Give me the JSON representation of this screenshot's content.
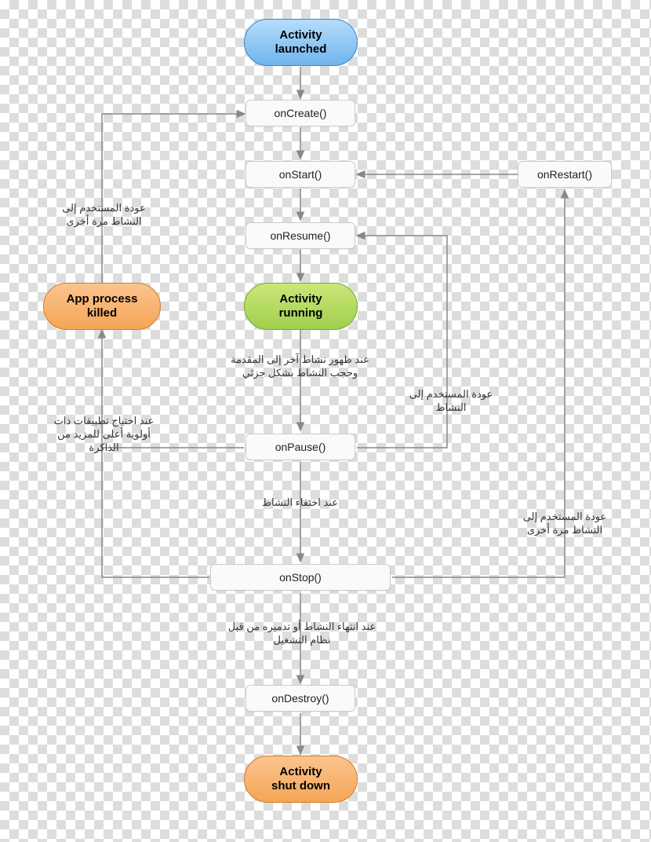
{
  "nodes": {
    "launched": "Activity\nlaunched",
    "oncreate": "onCreate()",
    "onstart": "onStart()",
    "onresume": "onResume()",
    "running": "Activity\nrunning",
    "onpause": "onPause()",
    "onstop": "onStop()",
    "ondestroy": "onDestroy()",
    "shutdown": "Activity\nshut down",
    "onrestart": "onRestart()",
    "appkilled": "App process\nkilled"
  },
  "labels": {
    "return_again_left": "عودة المستخدم إلى\nالنشاط مرة أخرى",
    "higher_priority": "عند احتياج تطبيقات ذات\nأولوية أعلى للمزيد من\nالذاكرة",
    "another_activity": "عند ظهور نشاط آخر إلى المقدمة\nوحجب النشاط بشكل جزئي",
    "no_longer_visible": "عند اختفاء النشاط",
    "finishing": "عند انتهاء النشاط أو  تدميره من قبل\nنظام التشغيل",
    "return_right": "عودة المستخدم إلى\nالنشاط",
    "return_again_right": "عودة المستخدم إلى\nالنشاط مرة أخرى"
  }
}
